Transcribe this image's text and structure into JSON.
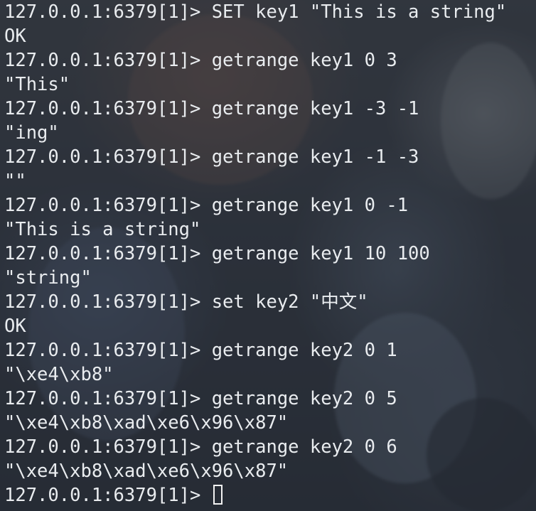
{
  "terminal": {
    "prompt": "127.0.0.1:6379[1]>",
    "lines": [
      {
        "kind": "command",
        "text": "SET key1 \"This is a string\""
      },
      {
        "kind": "output",
        "text": "OK"
      },
      {
        "kind": "command",
        "text": "getrange key1 0 3"
      },
      {
        "kind": "output",
        "text": "\"This\""
      },
      {
        "kind": "command",
        "text": "getrange key1 -3 -1"
      },
      {
        "kind": "output",
        "text": "\"ing\""
      },
      {
        "kind": "command",
        "text": "getrange key1 -1 -3"
      },
      {
        "kind": "output",
        "text": "\"\""
      },
      {
        "kind": "command",
        "text": "getrange key1 0 -1"
      },
      {
        "kind": "output",
        "text": "\"This is a string\""
      },
      {
        "kind": "command",
        "text": "getrange key1 10 100"
      },
      {
        "kind": "output",
        "text": "\"string\""
      },
      {
        "kind": "command",
        "text": "set key2 \"中文\""
      },
      {
        "kind": "output",
        "text": "OK"
      },
      {
        "kind": "command",
        "text": "getrange key2 0 1"
      },
      {
        "kind": "output",
        "text": "\"\\xe4\\xb8\""
      },
      {
        "kind": "command",
        "text": "getrange key2 0 5"
      },
      {
        "kind": "output",
        "text": "\"\\xe4\\xb8\\xad\\xe6\\x96\\x87\""
      },
      {
        "kind": "command",
        "text": "getrange key2 0 6"
      },
      {
        "kind": "output",
        "text": "\"\\xe4\\xb8\\xad\\xe6\\x96\\x87\""
      }
    ],
    "current_input": ""
  },
  "colors": {
    "text": "#e9ecef",
    "background_tint": "#22262e",
    "cursor": "#f2f2f2"
  }
}
